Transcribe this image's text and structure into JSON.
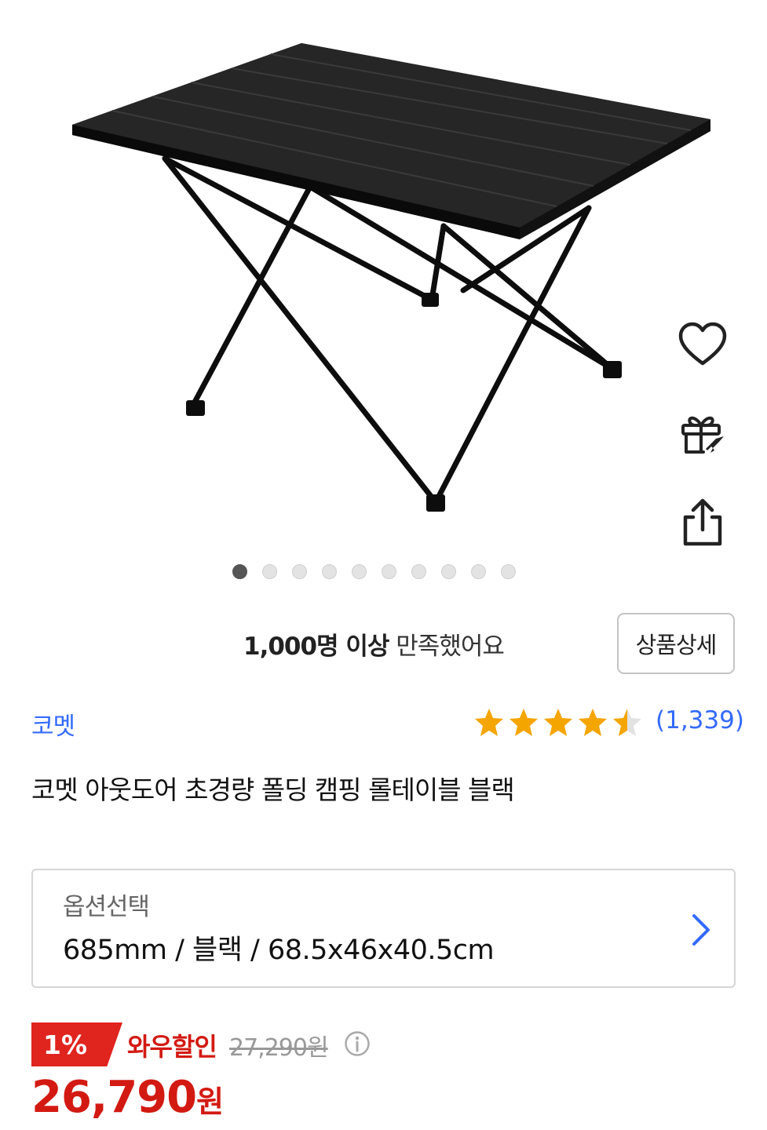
{
  "gallery": {
    "total_images": 10,
    "active_index": 0
  },
  "actions": {
    "wishlist_icon": "heart-icon",
    "gift_icon": "gift-icon",
    "share_icon": "share-icon"
  },
  "satisfaction": {
    "strong": "1,000명 이상",
    "rest": "만족했어요"
  },
  "detail_button_label": "상품상세",
  "product": {
    "brand": "코멧",
    "rating": 4.5,
    "review_count": "(1,339)",
    "title": "코멧 아웃도어 초경량 폴딩 캠핑 롤테이블 블랙"
  },
  "option": {
    "label": "옵션선택",
    "value": "685mm / 블랙 / 68.5x46x40.5cm",
    "chevron_icon": "chevron-right-icon"
  },
  "pricing": {
    "discount_rate": "1%",
    "discount_label": "와우할인",
    "original_price": "27,290원",
    "sale_price": "26,790",
    "currency": "원"
  },
  "colors": {
    "accent_blue": "#346aff",
    "sale_red": "#d31a12",
    "badge_red": "#e0241e",
    "star_yellow": "#f5a500"
  }
}
